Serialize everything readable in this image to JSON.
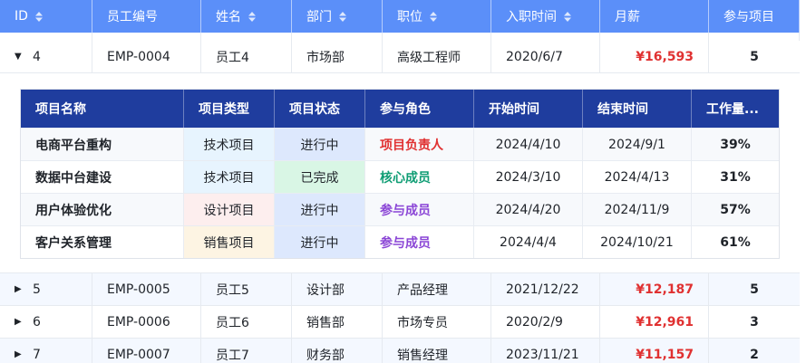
{
  "columns": [
    "ID",
    "员工编号",
    "姓名",
    "部门",
    "职位",
    "入职时间",
    "月薪",
    "参与项目"
  ],
  "expanded_row": {
    "id": "4",
    "emp_no": "EMP-0004",
    "name": "员工4",
    "dept": "市场部",
    "title": "高级工程师",
    "hire_date": "2020/6/7",
    "salary": "¥16,593",
    "projects": "5"
  },
  "sub_columns": [
    "项目名称",
    "项目类型",
    "项目状态",
    "参与角色",
    "开始时间",
    "结束时间",
    "工作量..."
  ],
  "sub_rows": [
    {
      "name": "电商平台重构",
      "type": "技术项目",
      "status": "进行中",
      "role": "项目负责人",
      "start": "2024/4/10",
      "end": "2024/9/1",
      "load": "39%"
    },
    {
      "name": "数据中台建设",
      "type": "技术项目",
      "status": "已完成",
      "role": "核心成员",
      "start": "2024/3/10",
      "end": "2024/4/13",
      "load": "31%"
    },
    {
      "name": "用户体验优化",
      "type": "设计项目",
      "status": "进行中",
      "role": "参与成员",
      "start": "2024/4/20",
      "end": "2024/11/9",
      "load": "57%"
    },
    {
      "name": "客户关系管理",
      "type": "销售项目",
      "status": "进行中",
      "role": "参与成员",
      "start": "2024/4/4",
      "end": "2024/10/21",
      "load": "61%"
    }
  ],
  "rows": [
    {
      "id": "5",
      "emp_no": "EMP-0005",
      "name": "员工5",
      "dept": "设计部",
      "title": "产品经理",
      "hire_date": "2021/12/22",
      "salary": "¥12,187",
      "projects": "5"
    },
    {
      "id": "6",
      "emp_no": "EMP-0006",
      "name": "员工6",
      "dept": "销售部",
      "title": "市场专员",
      "hire_date": "2020/2/9",
      "salary": "¥12,961",
      "projects": "3"
    },
    {
      "id": "7",
      "emp_no": "EMP-0007",
      "name": "员工7",
      "dept": "财务部",
      "title": "销售经理",
      "hire_date": "2023/11/21",
      "salary": "¥11,157",
      "projects": "2"
    }
  ],
  "icons": {
    "sort": "sort-icon",
    "expanded": "caret-down-icon",
    "collapsed": "caret-right-icon"
  },
  "colors": {
    "header": "#5b8ff9",
    "sub_header": "#1f3d9e",
    "salary": "#e03131",
    "role_lead": "#e03131",
    "role_core": "#0f9d74",
    "role_member": "#8b46d6"
  }
}
